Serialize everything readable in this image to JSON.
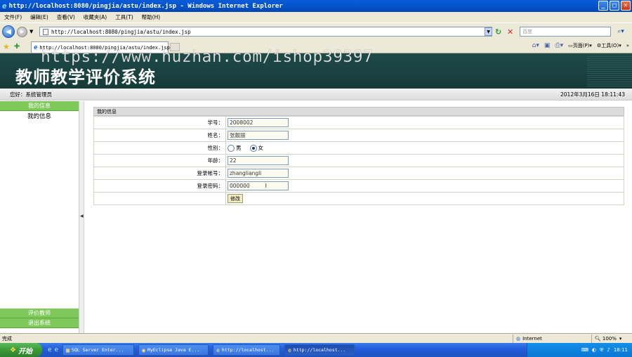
{
  "window": {
    "title": "http://localhost:8080/pingjia/astu/index.jsp - Windows Internet Explorer",
    "controls": [
      "_",
      "□",
      "✕"
    ]
  },
  "menu": [
    "文件(F)",
    "编辑(E)",
    "查看(V)",
    "收藏夹(A)",
    "工具(T)",
    "帮助(H)"
  ],
  "address": {
    "url": "http://localhost:8080/pingjia/astu/index.jsp",
    "search_placeholder": "百度"
  },
  "tab": {
    "title": "http://localhost:8080/pingjia/astu/index.jsp"
  },
  "command_bar": {
    "page_label": "页面(P)",
    "tools_label": "工具(O)"
  },
  "page": {
    "watermark": "https://www.huzhan.com/ishop39397",
    "system_title": "教师教学评价系统",
    "greeting": "您好：系统管理员",
    "datetime": "2012年3月16日  18:11:43",
    "sidebar": {
      "header": "我的信息",
      "items": [
        "我的信息"
      ],
      "bottom": [
        "评价教师",
        "退出系统"
      ]
    },
    "section_title": "我的信息",
    "form": {
      "student_id_label": "学号：",
      "student_id": "2008002",
      "name_label": "姓名：",
      "name": "张靓丽",
      "gender_label": "性别：",
      "gender_male": "男",
      "gender_female": "女",
      "age_label": "年龄：",
      "age": "22",
      "login_label": "登录帐号：",
      "login": "zhangliangli",
      "password_label": "登录密码：",
      "password": "000000",
      "submit": "修改"
    }
  },
  "status": {
    "text": "完成",
    "zone": "Internet",
    "zoom": "100%"
  },
  "taskbar": {
    "start": "开始",
    "tasks": [
      "SQL Server Enter...",
      "MyEclipse Java E...",
      "http://localhost...",
      "http://localhost..."
    ],
    "clock": "18:11"
  }
}
